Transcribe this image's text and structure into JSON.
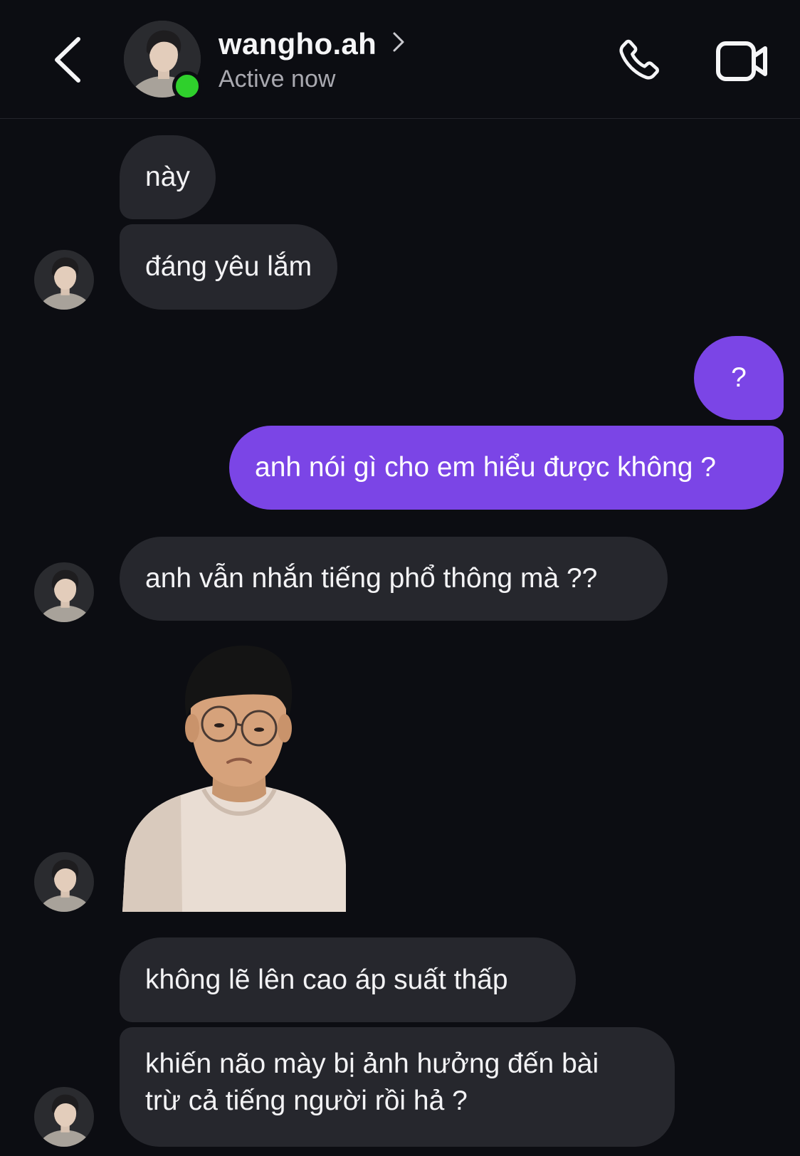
{
  "header": {
    "username": "wangho.ah",
    "status": "Active now",
    "back_icon": "chevron-left-icon",
    "call_icon": "phone-icon",
    "video_icon": "video-camera-icon",
    "online_color": "#2fd02c"
  },
  "messages": [
    {
      "direction": "incoming",
      "text": "này"
    },
    {
      "direction": "incoming",
      "text": "đáng yêu lắm"
    },
    {
      "direction": "outgoing",
      "text": "?"
    },
    {
      "direction": "outgoing",
      "text": "anh nói gì cho em hiểu được không ?"
    },
    {
      "direction": "incoming",
      "text": "anh vẫn nhắn tiếng phổ thông mà ??"
    },
    {
      "direction": "incoming",
      "type": "sticker"
    },
    {
      "direction": "incoming",
      "text": "không lẽ lên cao áp suất thấp"
    },
    {
      "direction": "incoming",
      "text_lines": [
        "khiến não mày bị ảnh hưởng đến bài",
        "trừ cả tiếng người rồi hả ?"
      ]
    }
  ],
  "colors": {
    "background": "#0c0d12",
    "incoming_bubble": "#26272d",
    "outgoing_bubble": "#7b45e6"
  }
}
